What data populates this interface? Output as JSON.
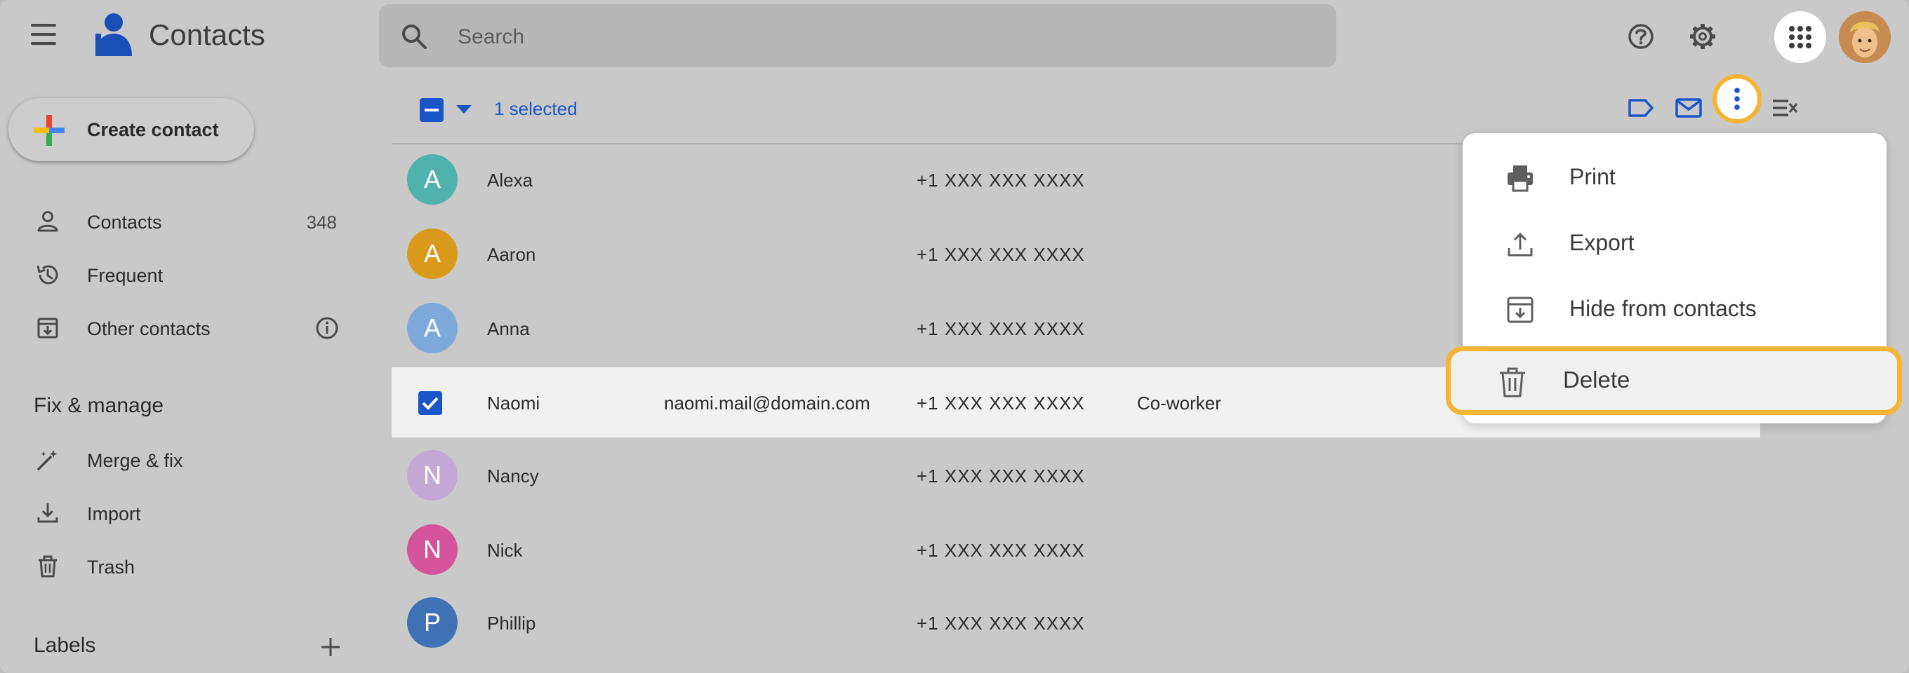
{
  "app": {
    "title": "Contacts"
  },
  "search": {
    "placeholder": "Search"
  },
  "sidebar": {
    "create_label": "Create contact",
    "items": [
      {
        "label": "Contacts",
        "count": "348",
        "icon": "person-icon"
      },
      {
        "label": "Frequent",
        "icon": "history-icon"
      },
      {
        "label": "Other contacts",
        "icon": "archive-in-icon"
      }
    ],
    "fix_manage_title": "Fix & manage",
    "fix_items": [
      {
        "label": "Merge & fix",
        "icon": "magic-wand-icon"
      },
      {
        "label": "Import",
        "icon": "download-icon"
      },
      {
        "label": "Trash",
        "icon": "trash-icon"
      }
    ],
    "labels_title": "Labels"
  },
  "toolbar": {
    "selected_text": "1 selected"
  },
  "contacts": [
    {
      "initial": "A",
      "name": "Alexa",
      "email": "",
      "phone": "+1 XXX XXX XXXX",
      "label": "",
      "color": "#4fb2ad",
      "selected": false
    },
    {
      "initial": "A",
      "name": "Aaron",
      "email": "",
      "phone": "+1 XXX XXX XXXX",
      "label": "",
      "color": "#d99a1c",
      "selected": false
    },
    {
      "initial": "A",
      "name": "Anna",
      "email": "",
      "phone": "+1 XXX XXX XXXX",
      "label": "",
      "color": "#7fa9da",
      "selected": false
    },
    {
      "initial": "",
      "name": "Naomi",
      "email": "naomi.mail@domain.com",
      "phone": "+1 XXX XXX XXXX",
      "label": "Co-worker",
      "color": "#1a56c8",
      "selected": true
    },
    {
      "initial": "N",
      "name": "Nancy",
      "email": "",
      "phone": "+1 XXX XXX XXXX",
      "label": "",
      "color": "#c3a8d6",
      "selected": false
    },
    {
      "initial": "N",
      "name": "Nick",
      "email": "",
      "phone": "+1 XXX XXX XXXX",
      "label": "",
      "color": "#d4549c",
      "selected": false
    },
    {
      "initial": "P",
      "name": "Phillip",
      "email": "",
      "phone": "+1 XXX XXX XXXX",
      "label": "",
      "color": "#3f72b4",
      "selected": false
    }
  ],
  "menu": {
    "items": [
      {
        "label": "Print",
        "icon": "print-icon"
      },
      {
        "label": "Export",
        "icon": "upload-icon"
      },
      {
        "label": "Hide from contacts",
        "icon": "archive-in-icon"
      },
      {
        "label": "Delete",
        "icon": "trash-icon"
      }
    ]
  },
  "colors": {
    "accent": "#1a56c8",
    "highlight": "#f5b431"
  }
}
